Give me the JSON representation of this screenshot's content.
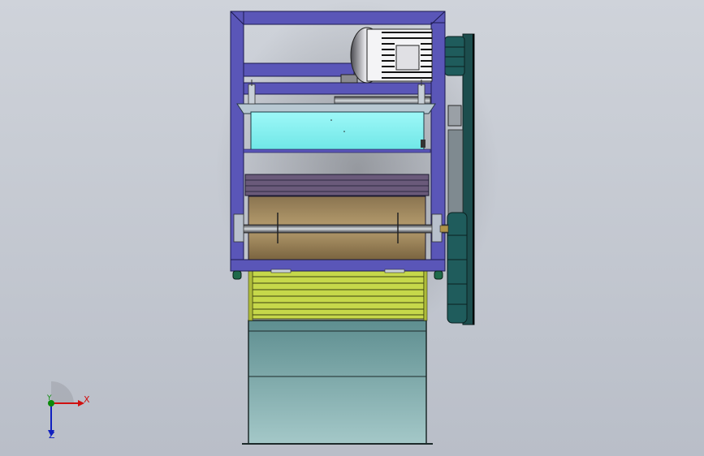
{
  "viewport": {
    "background": "#c4c8d0"
  },
  "colors": {
    "frame": "#5a56b8",
    "frame_dark": "#2a2870",
    "hopper": "#7ff2f2",
    "roller": "#a08a60",
    "conveyor": "#c6d84a",
    "bin": "#6f9e9e",
    "pulley": "#1f5c5c",
    "motor_body": "#9a9aa0",
    "foot": "#1f6a4a"
  },
  "triad": {
    "x_label": "X",
    "y_label": "Y",
    "z_label": "Z",
    "x_color": "#d01010",
    "y_color": "#0a8a0a",
    "z_color": "#1020c0"
  }
}
